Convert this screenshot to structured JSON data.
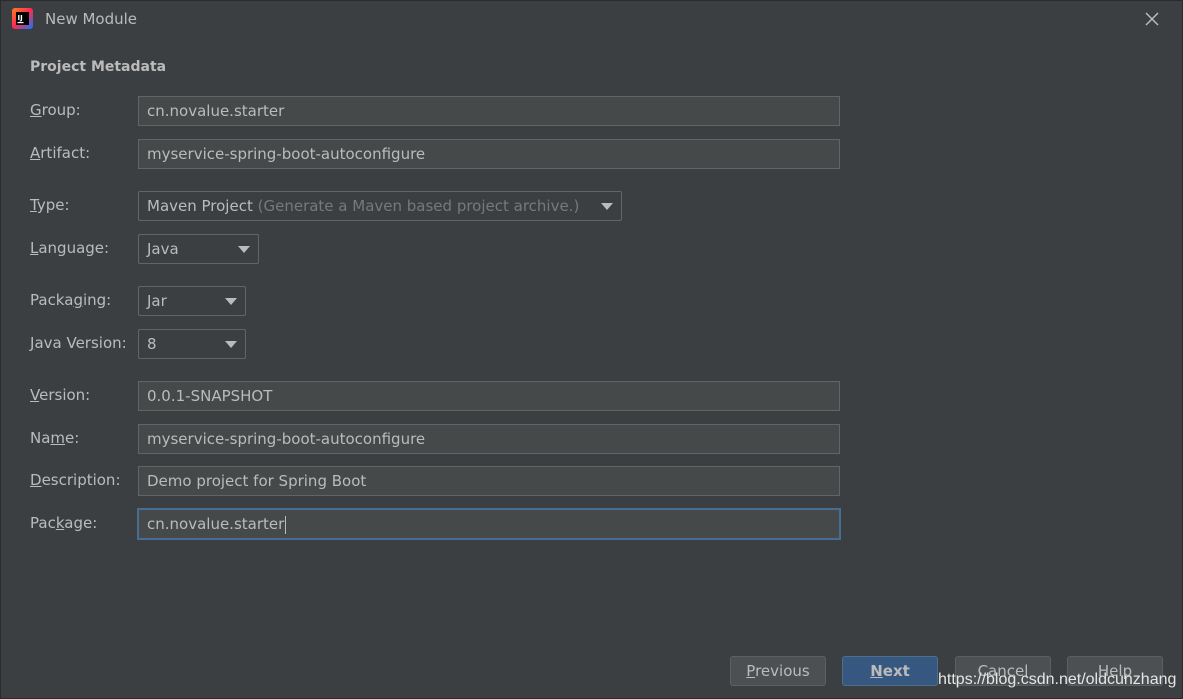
{
  "window": {
    "title": "New Module",
    "icon": "intellij-idea-icon",
    "close_icon": "close-icon"
  },
  "form": {
    "section_title": "Project Metadata",
    "group": {
      "label_pre": "",
      "label_mn": "G",
      "label_post": "roup:",
      "value": "cn.novalue.starter"
    },
    "artifact": {
      "label_pre": "",
      "label_mn": "A",
      "label_post": "rtifact:",
      "value": "myservice-spring-boot-autoconfigure"
    },
    "type": {
      "label_pre": "",
      "label_mn": "T",
      "label_post": "ype:",
      "value": "Maven Project",
      "hint": "(Generate a Maven based project archive.)"
    },
    "language": {
      "label_pre": "",
      "label_mn": "L",
      "label_post": "anguage:",
      "value": "Java"
    },
    "packaging": {
      "label_pre": "Packa",
      "label_mn": "g",
      "label_post": "ing:",
      "value": "Jar"
    },
    "java_version": {
      "label_pre": "",
      "label_mn": "J",
      "label_post": "ava Version:",
      "value": "8"
    },
    "version": {
      "label_pre": "",
      "label_mn": "V",
      "label_post": "ersion:",
      "value": "0.0.1-SNAPSHOT"
    },
    "name": {
      "label_pre": "Na",
      "label_mn": "m",
      "label_post": "e:",
      "value": "myservice-spring-boot-autoconfigure"
    },
    "description": {
      "label_pre": "",
      "label_mn": "D",
      "label_post": "escription:",
      "value": "Demo project for Spring Boot"
    },
    "package": {
      "label_pre": "Pac",
      "label_mn": "k",
      "label_post": "age:",
      "value": "cn.novalue.starter"
    }
  },
  "buttons": {
    "previous": {
      "pre": "",
      "mn": "P",
      "post": "revious"
    },
    "next": {
      "pre": "",
      "mn": "N",
      "post": "ext"
    },
    "cancel": {
      "label": "Cancel"
    },
    "help": {
      "label": "Help"
    }
  },
  "watermark": "https://blog.csdn.net/oldcunzhang",
  "colors": {
    "background": "#3c3f41",
    "field_bg": "#45494a",
    "focus_border": "#466d94",
    "primary_button": "#365880"
  }
}
